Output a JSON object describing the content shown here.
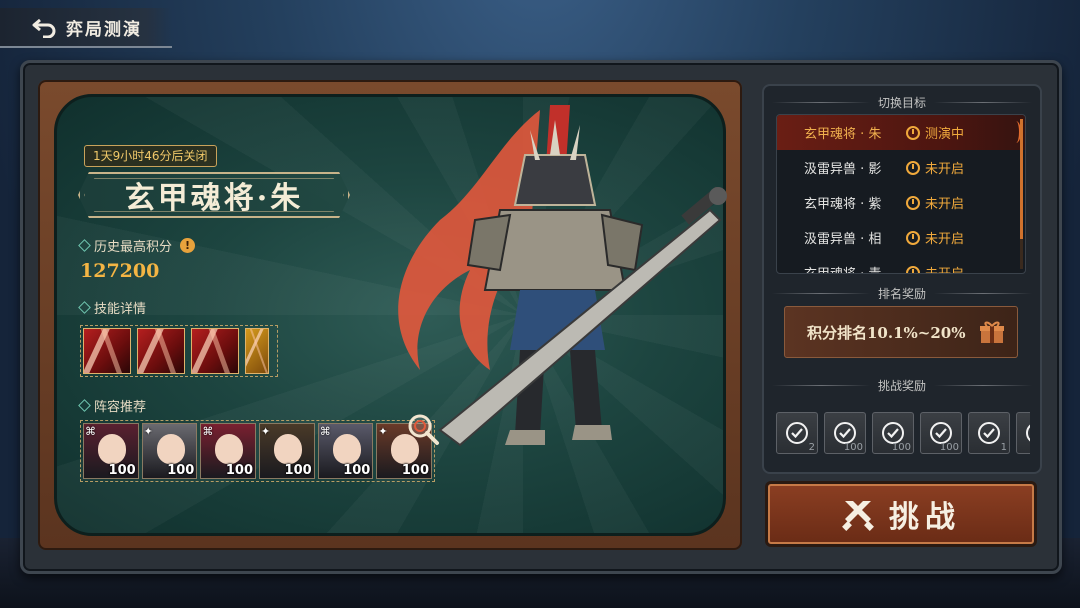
{
  "header": {
    "title": "弈局测演"
  },
  "boss": {
    "timer": "1天9小时46分后关闭",
    "name": "玄甲魂将·朱",
    "history_label": "历史最高积分",
    "history_score": "127200",
    "skills_label": "技能详情",
    "team_label": "阵容推荐"
  },
  "team": [
    {
      "level": "100",
      "tag": "⌘"
    },
    {
      "level": "100",
      "tag": "✦"
    },
    {
      "level": "100",
      "tag": "⌘"
    },
    {
      "level": "100",
      "tag": "✦"
    },
    {
      "level": "100",
      "tag": "⌘"
    },
    {
      "level": "100",
      "tag": "✦"
    }
  ],
  "switch_target": {
    "heading": "切换目标",
    "items": [
      {
        "name": "玄甲魂将 · 朱",
        "status": "测演中",
        "active": true
      },
      {
        "name": "汲雷异兽 · 影",
        "status": "未开启",
        "active": false
      },
      {
        "name": "玄甲魂将 · 紫",
        "status": "未开启",
        "active": false
      },
      {
        "name": "汲雷异兽 · 相",
        "status": "未开启",
        "active": false
      },
      {
        "name": "玄甲魂将 · 青",
        "status": "未开启",
        "active": false
      }
    ]
  },
  "rank_reward": {
    "heading": "排名奖励",
    "text": "积分排名10.1%~20%"
  },
  "challenge_reward": {
    "heading": "挑战奖励",
    "counts": [
      "2",
      "100",
      "100",
      "100",
      "1",
      ""
    ]
  },
  "challenge_button": {
    "label": "挑战"
  },
  "colors": {
    "accent_orange": "#f0a93c",
    "score_gold": "#f4b544",
    "screen_teal": "#1d4540",
    "button_rust": "#7a3419"
  },
  "hero_palettes": [
    "#5a2030",
    "#6a6a70",
    "#7a2030",
    "#4a3a28",
    "#5a5a6a",
    "#6a3a28"
  ]
}
